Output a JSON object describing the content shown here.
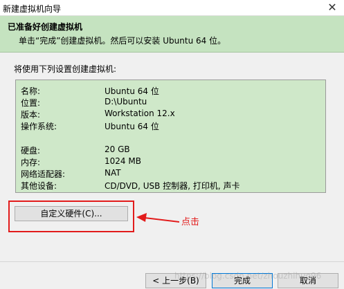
{
  "window": {
    "title": "新建虚拟机向导",
    "close_glyph": "✕"
  },
  "header": {
    "title": "已准备好创建虚拟机",
    "subtitle": "单击“完成”创建虚拟机。然后可以安装 Ubuntu 64 位。"
  },
  "intro": "将使用下列设置创建虚拟机:",
  "summary": [
    {
      "key": "名称:",
      "value": "Ubuntu 64 位"
    },
    {
      "key": "位置:",
      "value": "D:\\Ubuntu"
    },
    {
      "key": "版本:",
      "value": "Workstation 12.x"
    },
    {
      "key": "操作系统:",
      "value": "Ubuntu 64 位"
    },
    {
      "key": "硬盘:",
      "value": "20 GB"
    },
    {
      "key": "内存:",
      "value": "1024 MB"
    },
    {
      "key": "网络适配器:",
      "value": "NAT"
    },
    {
      "key": "其他设备:",
      "value": "CD/DVD, USB 控制器, 打印机, 声卡"
    }
  ],
  "customize_button": "自定义硬件(C)...",
  "annotation": "点击",
  "buttons": {
    "back": "< 上一步(B)",
    "finish": "完成",
    "cancel": "取消"
  },
  "watermark": "https://blog.csdn.net/zhouzhihuo96",
  "colors": {
    "header_bg": "#c5e3c0",
    "summary_bg": "#cfe8c9",
    "annotation_red": "#e21b1b"
  }
}
